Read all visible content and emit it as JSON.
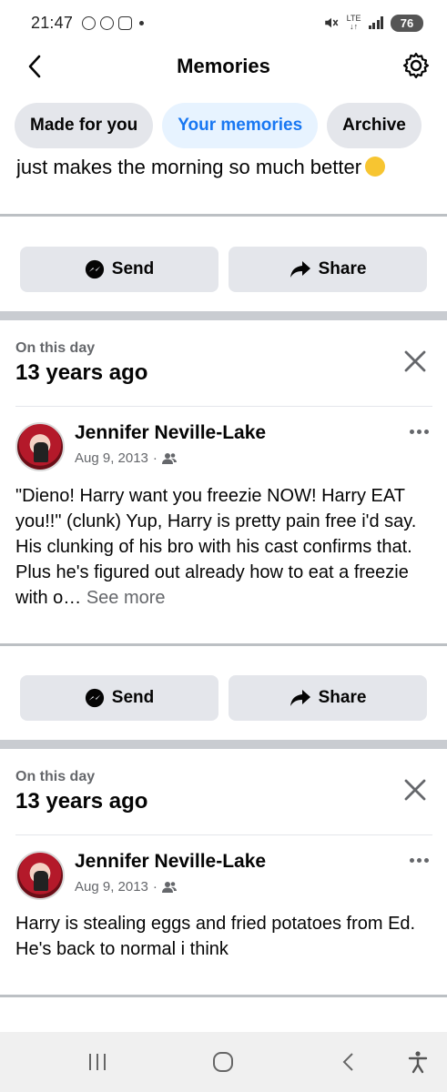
{
  "status_bar": {
    "time": "21:47",
    "network": "LTE",
    "battery": "76"
  },
  "header": {
    "title": "Memories",
    "back_icon": "back-arrow-icon",
    "settings_icon": "gear-icon"
  },
  "tabs": [
    {
      "label": "Made for you",
      "active": false
    },
    {
      "label": "Your memories",
      "active": true
    },
    {
      "label": "Archive",
      "active": false
    }
  ],
  "clipped_post_text": "just makes the morning so much better",
  "actions": {
    "send_label": "Send",
    "share_label": "Share"
  },
  "memories": [
    {
      "label": "On this day",
      "years_ago": "13 years ago",
      "author": "Jennifer Neville-Lake",
      "date": "Aug 9, 2013",
      "separator": "·",
      "audience_icon": "friends-icon",
      "text": "\"Dieno!  Harry want you freezie NOW!  Harry EAT you!!\"  (clunk)  Yup, Harry is pretty pain free i'd say.  His clunking of his bro with his cast confirms that.  Plus he's figured out already how to eat a freezie with o…",
      "see_more": "See more"
    },
    {
      "label": "On this day",
      "years_ago": "13 years ago",
      "author": "Jennifer Neville-Lake",
      "date": "Aug 9, 2013",
      "separator": "·",
      "audience_icon": "friends-icon",
      "text": "Harry is stealing eggs and fried potatoes from Ed.  He's back to normal i think"
    }
  ],
  "colors": {
    "accent": "#1877f2",
    "active_tab_bg": "#e7f3ff",
    "button_bg": "#e4e6eb",
    "secondary_text": "#65676b"
  }
}
